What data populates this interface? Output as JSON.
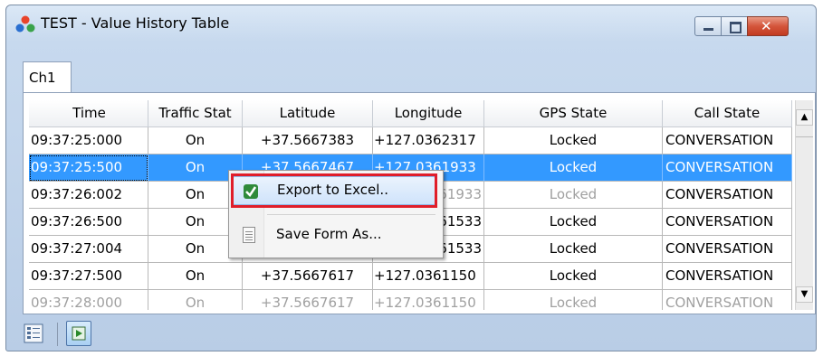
{
  "window": {
    "title": "TEST - Value History Table",
    "controls": {
      "minimize": "minimize",
      "maximize": "maximize",
      "close": "✕"
    }
  },
  "tabs": [
    {
      "label": "Ch1",
      "active": true
    }
  ],
  "table": {
    "columns": [
      "Time",
      "Traffic Stat",
      "Latitude",
      "Longitude",
      "GPS State",
      "Call State"
    ],
    "rows": [
      {
        "time": "09:37:25:000",
        "traffic": "On",
        "lat": "+37.5667383",
        "lon": "+127.0362317",
        "gps": "Locked",
        "call": "CONVERSATION"
      },
      {
        "time": "09:37:25:500",
        "traffic": "On",
        "lat": "+37.5667467",
        "lon": "+127.0361933",
        "gps": "Locked",
        "call": "CONVERSATION",
        "selected": true
      },
      {
        "time": "09:37:26:002",
        "traffic": "On",
        "lat": "",
        "lon": "61933",
        "gps": "Locked",
        "call": "CONVERSATION"
      },
      {
        "time": "09:37:26:500",
        "traffic": "On",
        "lat": "",
        "lon": "61533",
        "gps": "Locked",
        "call": "CONVERSATION"
      },
      {
        "time": "09:37:27:004",
        "traffic": "On",
        "lat": "",
        "lon": "61533",
        "gps": "Locked",
        "call": "CONVERSATION"
      },
      {
        "time": "09:37:27:500",
        "traffic": "On",
        "lat": "+37.5667617",
        "lon": "+127.0361150",
        "gps": "Locked",
        "call": "CONVERSATION"
      },
      {
        "time": "09:37:28:000",
        "traffic": "On",
        "lat": "+37.5667617",
        "lon": "+127.0361150",
        "gps": "Locked",
        "call": "CONVERSATION"
      }
    ]
  },
  "context_menu": {
    "items": [
      {
        "label": "Export to Excel..",
        "icon": "excel-export-icon",
        "highlighted": true
      },
      {
        "label": "Save Form As...",
        "icon": "document-icon"
      }
    ]
  },
  "colors": {
    "selection": "#3399ff",
    "highlight_box": "#e01e2a",
    "window_frame": "#c7d9ee"
  },
  "toolbar": {
    "buttons": [
      "grid-view-icon",
      "play-icon"
    ]
  }
}
